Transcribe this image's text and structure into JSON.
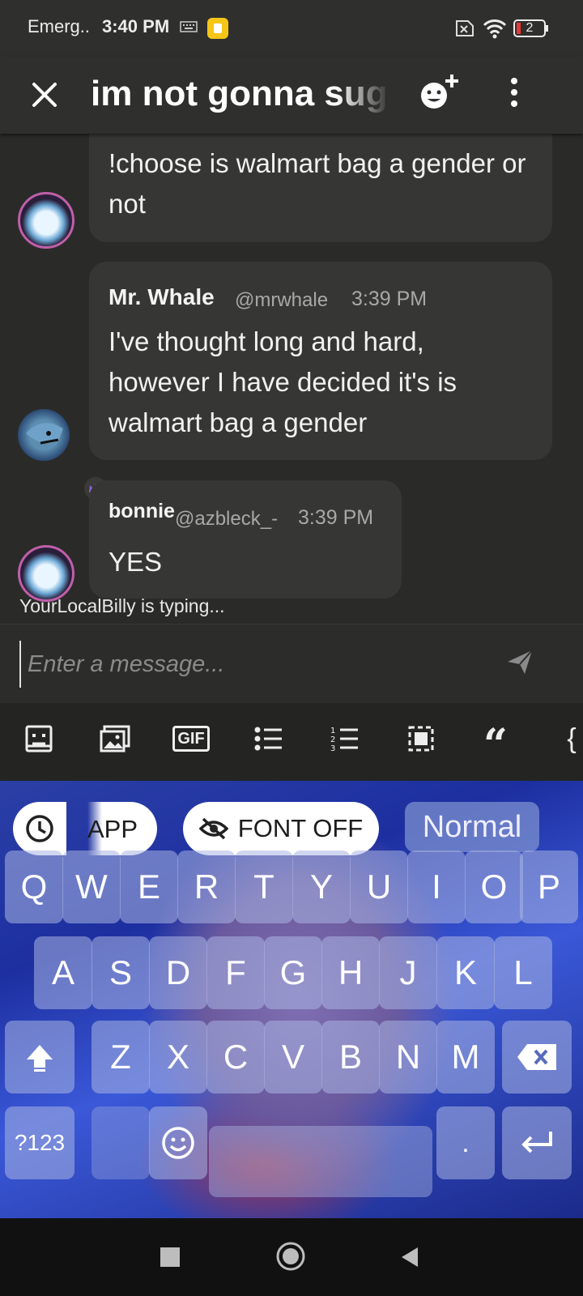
{
  "status_bar": {
    "carrier": "Emerg..",
    "time": "3:40 PM",
    "battery": "2"
  },
  "header": {
    "title": "im not gonna sugar"
  },
  "messages": [
    {
      "text": "!choose is walmart bag a gender or not"
    },
    {
      "name": "Mr. Whale",
      "handle": "@mrwhale",
      "time": "3:39 PM",
      "text": "I've thought long and hard, however I have decided it's is walmart bag a gender"
    },
    {
      "name": "bonnie",
      "handle": "@azbleck_-",
      "time": "3:39 PM",
      "text": "YES"
    }
  ],
  "typing_indicator": "YourLocalBilly is typing...",
  "composer": {
    "placeholder": "Enter a message..."
  },
  "toolbar": {
    "gif_label": "GIF",
    "quote_glyph": "“",
    "brace_glyph": "{"
  },
  "keyboard": {
    "app_label": "APP",
    "font_label": "FONT OFF",
    "style_label": "Normal",
    "row1": [
      "Q",
      "W",
      "E",
      "R",
      "T",
      "Y",
      "U",
      "I",
      "O",
      "P"
    ],
    "row2": [
      "A",
      "S",
      "D",
      "F",
      "G",
      "H",
      "J",
      "K",
      "L"
    ],
    "row3": [
      "Z",
      "X",
      "C",
      "V",
      "B",
      "N",
      "M"
    ],
    "symbols_label": "?123",
    "period_label": "."
  },
  "colors": {
    "background": "#2a2b29",
    "bubble": "#363735",
    "crown": "#8a63d2"
  }
}
